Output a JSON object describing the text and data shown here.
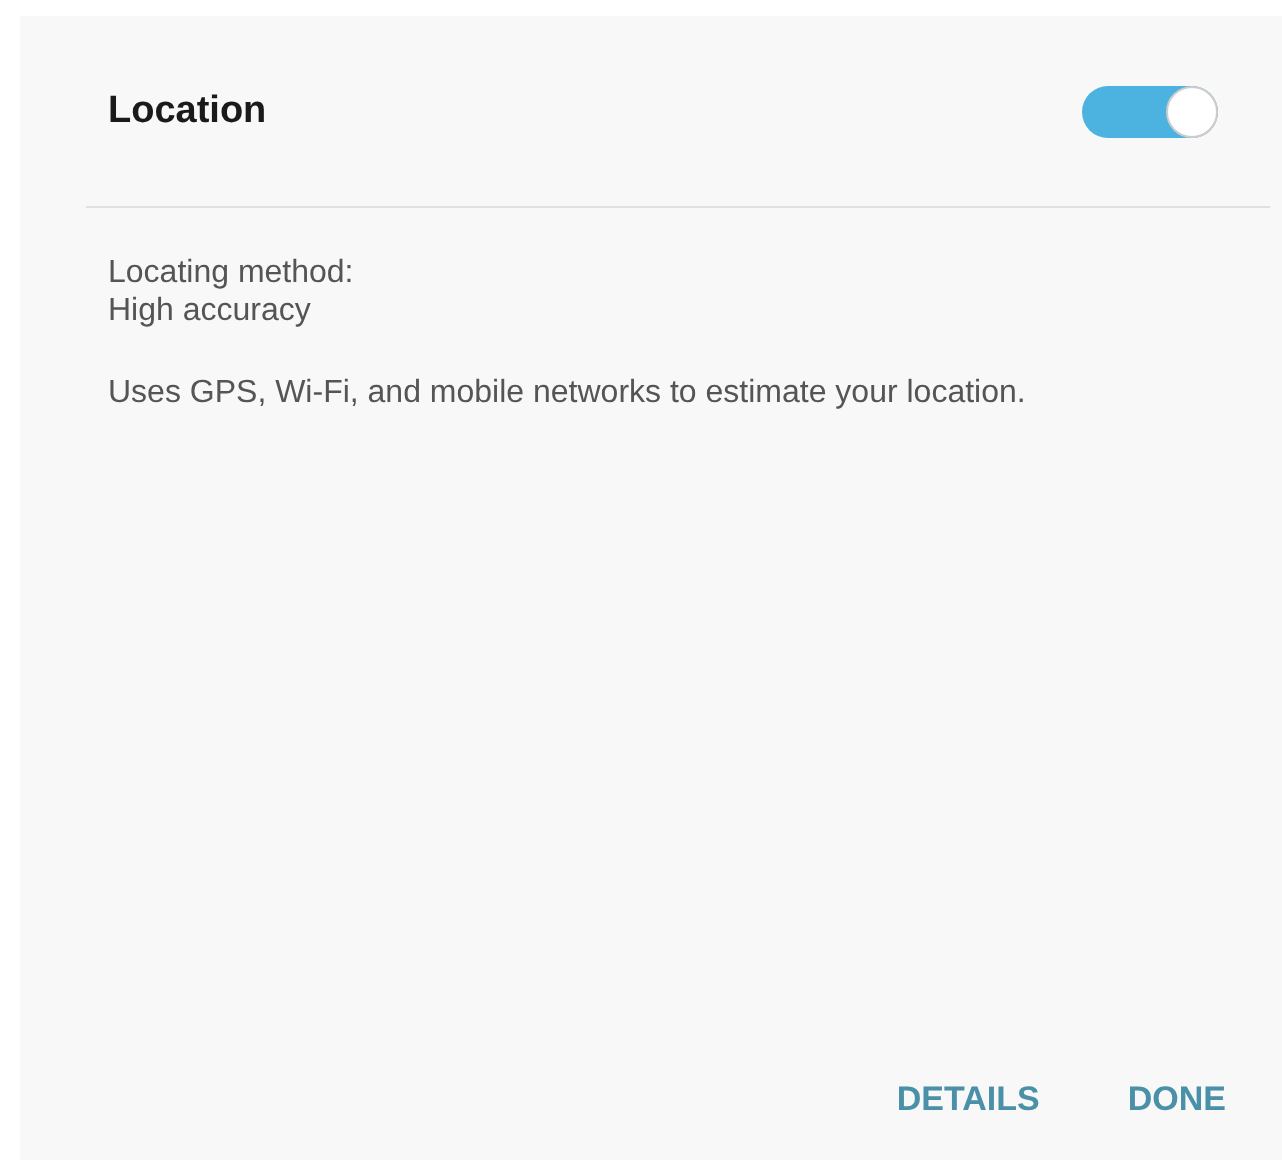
{
  "dialog": {
    "title": "Location",
    "toggle": {
      "on": true
    },
    "method_label": "Locating method:",
    "method_value": "High accuracy",
    "description": "Uses GPS, Wi-Fi, and mobile networks to estimate your location.",
    "buttons": [
      "DETAILS",
      "DONE"
    ]
  }
}
